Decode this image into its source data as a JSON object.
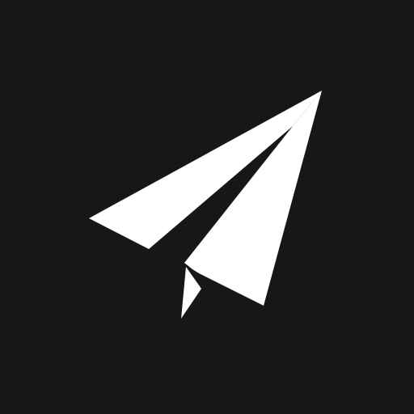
{
  "app": {
    "icon": "paper-plane-icon",
    "colors": {
      "background": "#171717",
      "plane": "#ffffff"
    }
  }
}
